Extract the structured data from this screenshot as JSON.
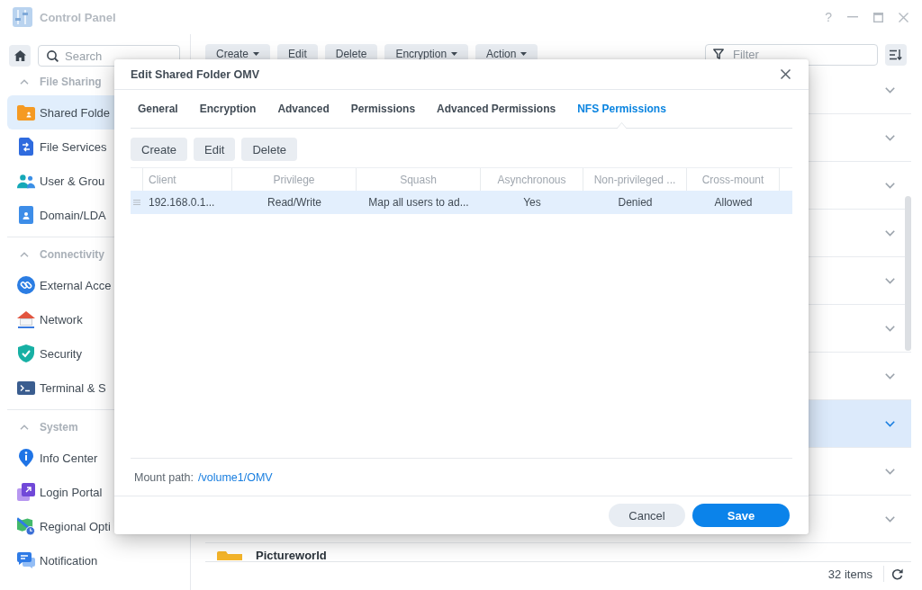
{
  "window": {
    "title": "Control Panel",
    "help": "?"
  },
  "sidebar": {
    "search": {
      "placeholder": "Search"
    },
    "sections": [
      {
        "title": "File Sharing",
        "expanded": true,
        "items": [
          {
            "label": "Shared Folde",
            "selected": true
          },
          {
            "label": "File Services",
            "selected": false
          },
          {
            "label": "User & Grou",
            "selected": false
          },
          {
            "label": "Domain/LDA",
            "selected": false
          }
        ]
      },
      {
        "title": "Connectivity",
        "expanded": true,
        "items": [
          {
            "label": "External Acce",
            "selected": false
          },
          {
            "label": "Network",
            "selected": false
          },
          {
            "label": "Security",
            "selected": false
          },
          {
            "label": "Terminal & S",
            "selected": false
          }
        ]
      },
      {
        "title": "System",
        "expanded": true,
        "items": [
          {
            "label": "Info Center",
            "selected": false
          },
          {
            "label": "Login Portal",
            "selected": false
          },
          {
            "label": "Regional Opti",
            "selected": false
          },
          {
            "label": "Notification",
            "selected": false
          }
        ]
      }
    ]
  },
  "toolbar": {
    "buttons": [
      {
        "label": "Create",
        "menu": true
      },
      {
        "label": "Edit",
        "menu": false
      },
      {
        "label": "Delete",
        "menu": false
      },
      {
        "label": "Encryption",
        "menu": true
      },
      {
        "label": "Action",
        "menu": true
      }
    ],
    "filter": {
      "placeholder": "Filter"
    }
  },
  "list": {
    "rows": [
      {
        "selected": false
      },
      {
        "selected": false
      },
      {
        "selected": false
      },
      {
        "selected": false
      },
      {
        "selected": false
      },
      {
        "selected": false
      },
      {
        "selected": false
      },
      {
        "selected": true
      },
      {
        "selected": false
      },
      {
        "selected": false
      },
      {
        "name": "Pictureworld",
        "selected": false
      }
    ]
  },
  "status_bar": {
    "count": "32 items"
  },
  "dialog": {
    "title": "Edit Shared Folder OMV",
    "tabs": [
      {
        "label": "General",
        "selected": false
      },
      {
        "label": "Encryption",
        "selected": false
      },
      {
        "label": "Advanced",
        "selected": false
      },
      {
        "label": "Permissions",
        "selected": false
      },
      {
        "label": "Advanced Permissions",
        "selected": false
      },
      {
        "label": "NFS Permissions",
        "selected": true
      }
    ],
    "toolbar": [
      "Create",
      "Edit",
      "Delete"
    ],
    "grid": {
      "columns": [
        "Client",
        "Privilege",
        "Squash",
        "Asynchronous",
        "Non-privileged ...",
        "Cross-mount"
      ],
      "rows": [
        {
          "selected": true,
          "cells": [
            "192.168.0.1...",
            "Read/Write",
            "Map all users to ad...",
            "Yes",
            "Denied",
            "Allowed"
          ]
        }
      ]
    },
    "mount_path": {
      "label": "Mount path:",
      "value": "/volume1/OMV"
    },
    "buttons": [
      {
        "label": "Cancel",
        "kind": "secondary"
      },
      {
        "label": "Save",
        "kind": "primary"
      }
    ]
  }
}
